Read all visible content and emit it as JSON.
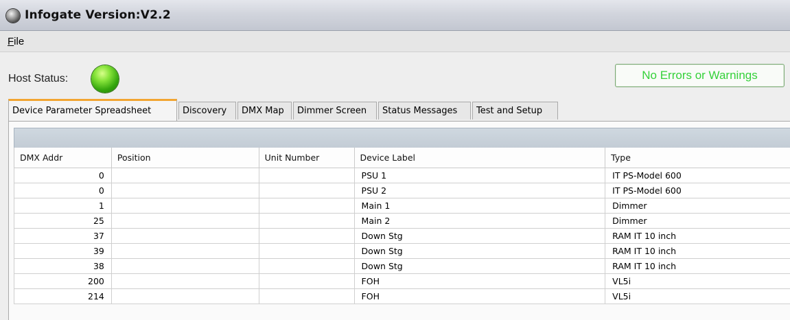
{
  "app": {
    "title": "Infogate Version:V2.2",
    "icon": "globe-icon"
  },
  "menu": {
    "file_label": "File"
  },
  "host": {
    "label": "Host Status:",
    "status_color": "#34a60d",
    "message": "No Errors or Warnings",
    "message_color": "#35d13a"
  },
  "tabs": [
    "Device Parameter Spreadsheet",
    "Discovery",
    "DMX Map",
    "Dimmer Screen",
    "Status Messages",
    "Test and Setup"
  ],
  "active_tab_color": "#f2a531",
  "table": {
    "columns": [
      "DMX Addr",
      "Position",
      "Unit Number",
      "Device Label",
      "Type"
    ],
    "rows": [
      [
        "0",
        "",
        "",
        "PSU 1",
        "IT PS-Model 600"
      ],
      [
        "0",
        "",
        "",
        "PSU 2",
        "IT PS-Model 600"
      ],
      [
        "1",
        "",
        "",
        "Main 1",
        "Dimmer"
      ],
      [
        "25",
        "",
        "",
        "Main 2",
        "Dimmer"
      ],
      [
        "37",
        "",
        "",
        "Down Stg",
        "RAM IT 10 inch"
      ],
      [
        "39",
        "",
        "",
        "Down Stg",
        "RAM IT 10 inch"
      ],
      [
        "38",
        "",
        "",
        "Down Stg",
        "RAM IT 10 inch"
      ],
      [
        "200",
        "",
        "",
        "FOH",
        "VL5i"
      ],
      [
        "214",
        "",
        "",
        "FOH",
        "VL5i"
      ]
    ]
  }
}
